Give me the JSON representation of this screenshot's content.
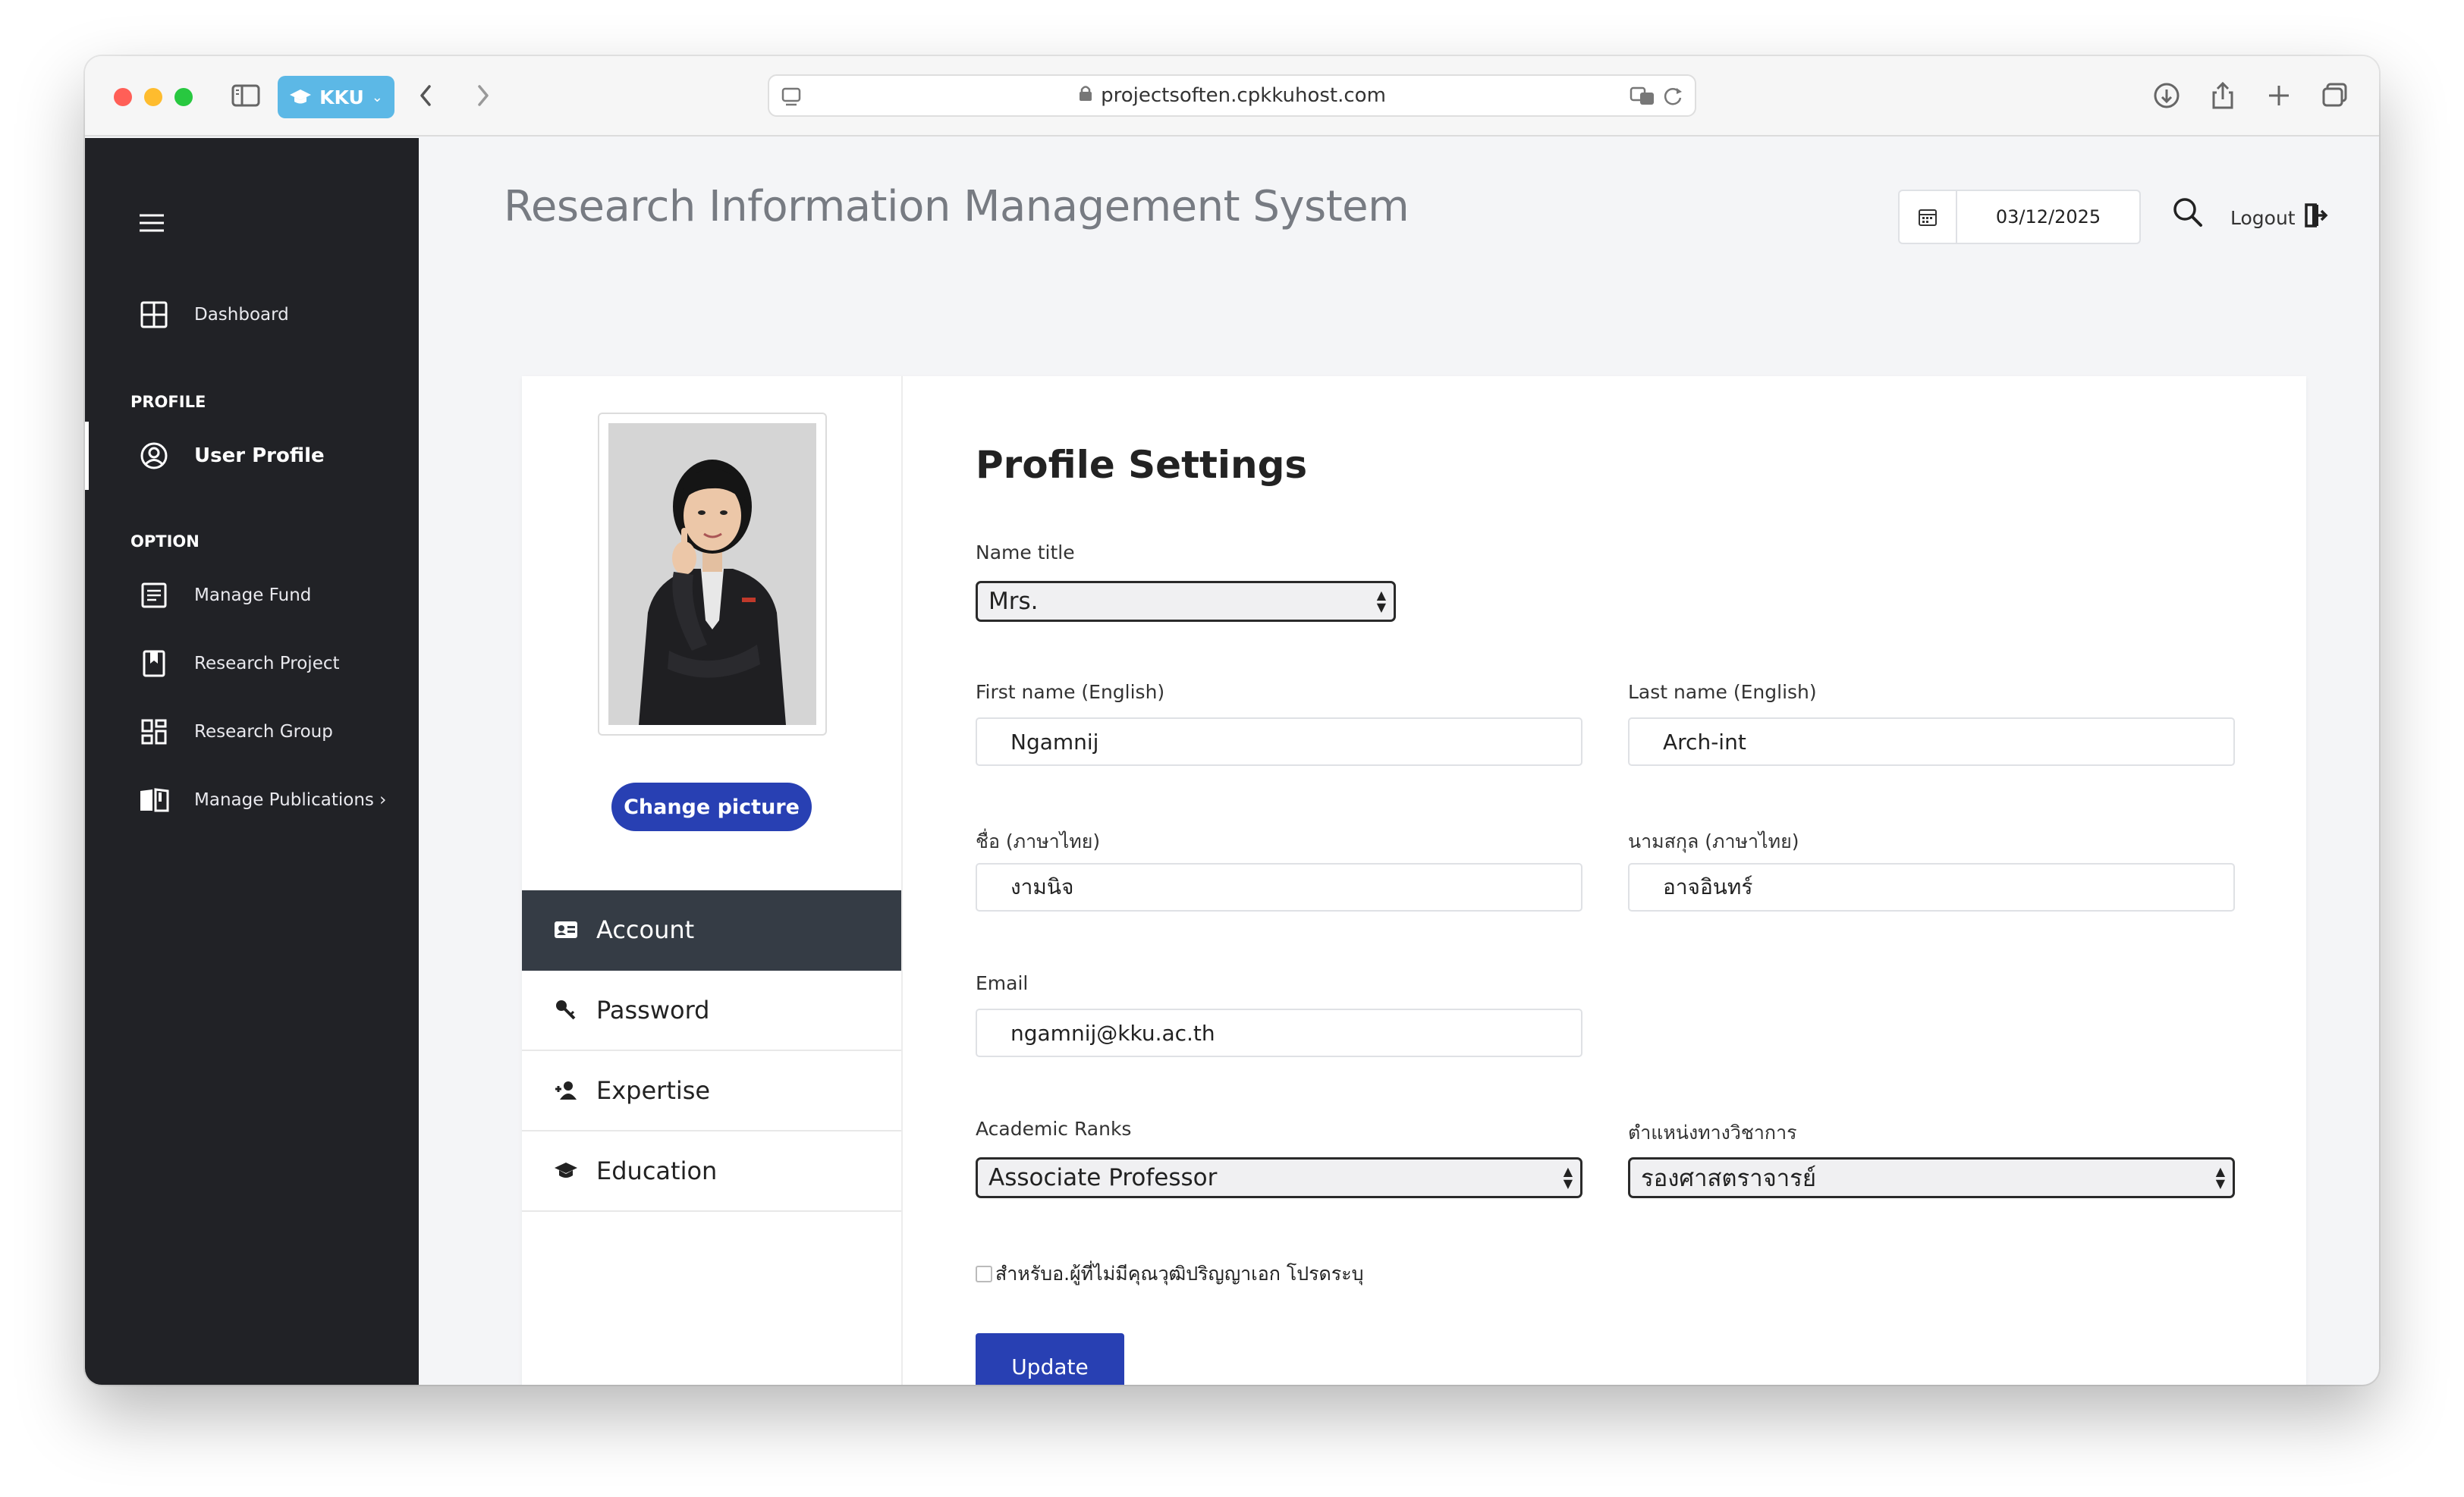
{
  "browser": {
    "tab_label": "KKU",
    "url": "projectsoften.cpkkuhost.com"
  },
  "sidebar": {
    "dashboard_label": "Dashboard",
    "section_profile": "PROFILE",
    "user_profile_label": "User Profile",
    "section_option": "OPTION",
    "items": [
      {
        "label": "Manage Fund",
        "icon": "document-list-icon"
      },
      {
        "label": "Research Project",
        "icon": "bookmark-icon"
      },
      {
        "label": "Research Group",
        "icon": "grid-icon"
      },
      {
        "label": "Manage Publications ›",
        "icon": "open-book-icon"
      }
    ]
  },
  "header": {
    "title": "Research Information Management System",
    "date": "03/12/2025",
    "logout_label": "Logout"
  },
  "profile_panel": {
    "change_picture_label": "Change picture",
    "tabs": [
      {
        "label": "Account",
        "icon": "id-card-icon",
        "active": true
      },
      {
        "label": "Password",
        "icon": "key-icon",
        "active": false
      },
      {
        "label": "Expertise",
        "icon": "user-plus-icon",
        "active": false
      },
      {
        "label": "Education",
        "icon": "graduation-cap-icon",
        "active": false
      }
    ]
  },
  "form": {
    "title": "Profile Settings",
    "name_title_label": "Name title",
    "name_title_value": "Mrs.",
    "first_name_en_label": "First name (English)",
    "first_name_en_value": "Ngamnij",
    "last_name_en_label": "Last name (English)",
    "last_name_en_value": "Arch-int",
    "first_name_th_label": "ชื่อ (ภาษาไทย)",
    "first_name_th_value": "งามนิจ",
    "last_name_th_label": "นามสกุล (ภาษาไทย)",
    "last_name_th_value": "อาจอินทร์",
    "email_label": "Email",
    "email_value": "ngamnij@kku.ac.th",
    "academic_rank_label": "Academic Ranks",
    "academic_rank_value": "Associate Professor",
    "academic_rank_th_label": "ตำแหน่งทางวิชาการ",
    "academic_rank_th_value": "รองศาสตราจารย์",
    "checkbox_label": "สำหรับอ.ผู้ที่ไม่มีคุณวุฒิปริญญาเอก โปรดระบุ",
    "update_label": "Update"
  },
  "colors": {
    "sidebar_bg": "#212226",
    "primary_button": "#2840b3",
    "active_tab": "#353c45",
    "kku_tab": "#5cb8e6"
  }
}
